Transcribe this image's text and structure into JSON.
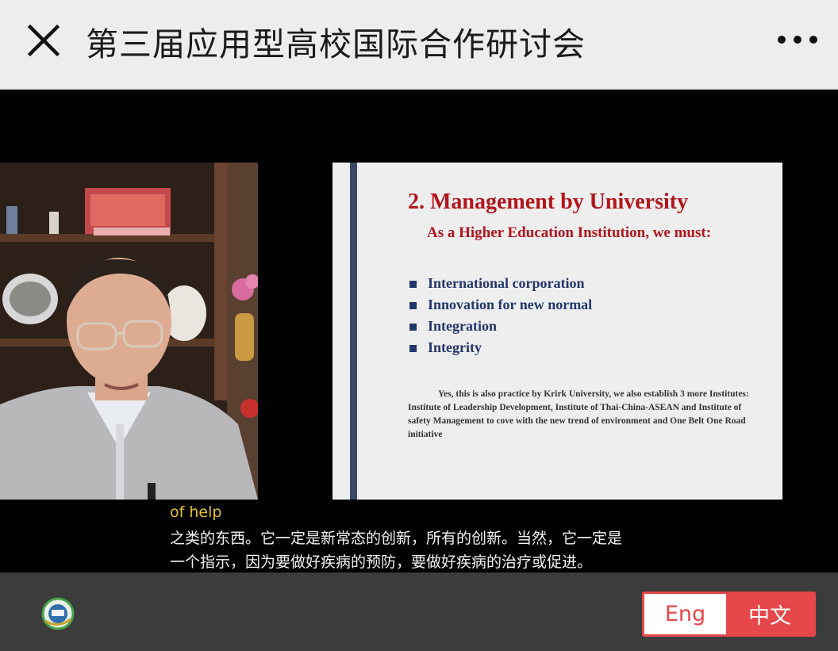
{
  "header": {
    "title": "第三届应用型高校国际合作研讨会",
    "close_icon": "close-icon",
    "more_icon": "more-horizontal-icon"
  },
  "slide": {
    "title": "2. Management by University",
    "subtitle": "As a Higher Education Institution, we must:",
    "bullets": [
      "International corporation",
      "Innovation for new normal",
      "Integration",
      "Integrity"
    ],
    "note": "Yes, this is also practice by Krirk University, we also establish  3 more Institutes: Institute of Leadership Development, Institute of Thai-China-ASEAN and Institute of safety Management to cove with the new trend of environment and One Belt One Road initiative"
  },
  "subtitles": {
    "english": "of help",
    "chinese_line1": "之类的东西。它一定是新常态的创新，所有的创新。当然，它一定是",
    "chinese_line2": "一个指示，因为要做好疾病的预防，要做好疾病的治疗或促进。"
  },
  "language_toggle": {
    "english_label": "Eng",
    "chinese_label": "中文",
    "selected": "中文"
  },
  "colors": {
    "accent": "#e5474b",
    "slide_title": "#b3151c",
    "bullet_text": "#23366b",
    "subtitle_english": "#e0c238"
  }
}
